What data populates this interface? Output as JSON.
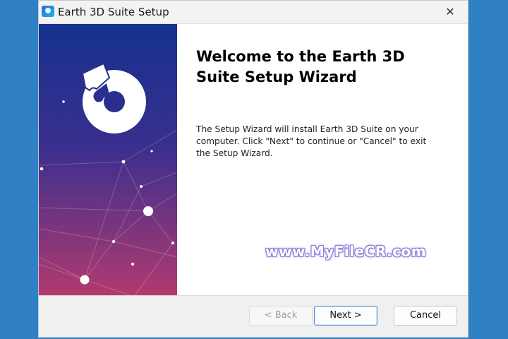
{
  "window": {
    "title": "Earth 3D Suite Setup",
    "close_glyph": "✕"
  },
  "content": {
    "heading": "Welcome to the Earth 3D Suite Setup Wizard",
    "description": "The Setup Wizard will install Earth 3D Suite on your computer.  Click \"Next\" to continue or \"Cancel\" to exit the Setup Wizard."
  },
  "watermark": "www.MyFileCR.com",
  "buttons": {
    "back": "< Back",
    "next": "Next >",
    "cancel": "Cancel"
  },
  "icons": {
    "app": "installer-app-icon",
    "logo": "puzzle-ring-logo-icon"
  },
  "colors": {
    "desktop": "#2f80c4",
    "banner_top": "#15318e",
    "banner_bottom": "#b23a6f"
  }
}
